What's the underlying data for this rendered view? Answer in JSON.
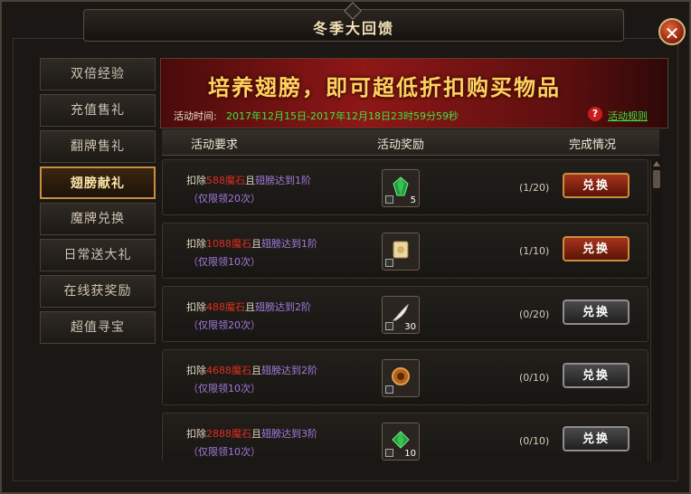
{
  "window": {
    "title": "冬季大回馈",
    "close_label": "✕"
  },
  "sidebar": {
    "items": [
      {
        "label": "双倍经验",
        "active": false
      },
      {
        "label": "充值售礼",
        "active": false
      },
      {
        "label": "翻牌售礼",
        "active": false
      },
      {
        "label": "翅膀献礼",
        "active": true
      },
      {
        "label": "魔牌兑换",
        "active": false
      },
      {
        "label": "日常送大礼",
        "active": false
      },
      {
        "label": "在线获奖励",
        "active": false
      },
      {
        "label": "超值寻宝",
        "active": false
      }
    ]
  },
  "banner": {
    "title": "培养翅膀，即可超低折扣购买物品",
    "time_label": "活动时间:",
    "time_value": "2017年12月15日-2017年12月18日23时59分59秒",
    "help_icon": "?",
    "rules_link": "活动规则"
  },
  "table": {
    "headers": {
      "requirement": "活动要求",
      "reward": "活动奖励",
      "status": "完成情况"
    },
    "rows": [
      {
        "prefix": "扣除",
        "cost": "588",
        "cost_unit": "魔石",
        "joiner": "且",
        "condition": "翅膀达到1阶",
        "limit": "（仅限领20次）",
        "item_icon": "green-gem-icon",
        "quantity": "5",
        "progress": "(1/20)",
        "button": "兑换",
        "button_active": true
      },
      {
        "prefix": "扣除",
        "cost": "1088",
        "cost_unit": "魔石",
        "joiner": "且",
        "condition": "翅膀达到1阶",
        "limit": "（仅限领10次）",
        "item_icon": "scroll-icon",
        "quantity": "",
        "progress": "(1/10)",
        "button": "兑换",
        "button_active": true
      },
      {
        "prefix": "扣除",
        "cost": "488",
        "cost_unit": "魔石",
        "joiner": "且",
        "condition": "翅膀达到2阶",
        "limit": "（仅限领20次）",
        "item_icon": "feather-icon",
        "quantity": "30",
        "progress": "(0/20)",
        "button": "兑换",
        "button_active": false
      },
      {
        "prefix": "扣除",
        "cost": "4688",
        "cost_unit": "魔石",
        "joiner": "且",
        "condition": "翅膀达到2阶",
        "limit": "（仅限领10次）",
        "item_icon": "bronze-ring-icon",
        "quantity": "",
        "progress": "(0/10)",
        "button": "兑换",
        "button_active": false
      },
      {
        "prefix": "扣除",
        "cost": "2888",
        "cost_unit": "魔石",
        "joiner": "且",
        "condition": "翅膀达到3阶",
        "limit": "（仅限领10次）",
        "item_icon": "green-gem-icon",
        "quantity": "10",
        "progress": "(0/10)",
        "button": "兑换",
        "button_active": false
      }
    ]
  },
  "colors": {
    "accent": "#c98f3e",
    "cost_red": "#e02e20",
    "condition_purple": "#a27adb",
    "time_green": "#3ee43e"
  }
}
